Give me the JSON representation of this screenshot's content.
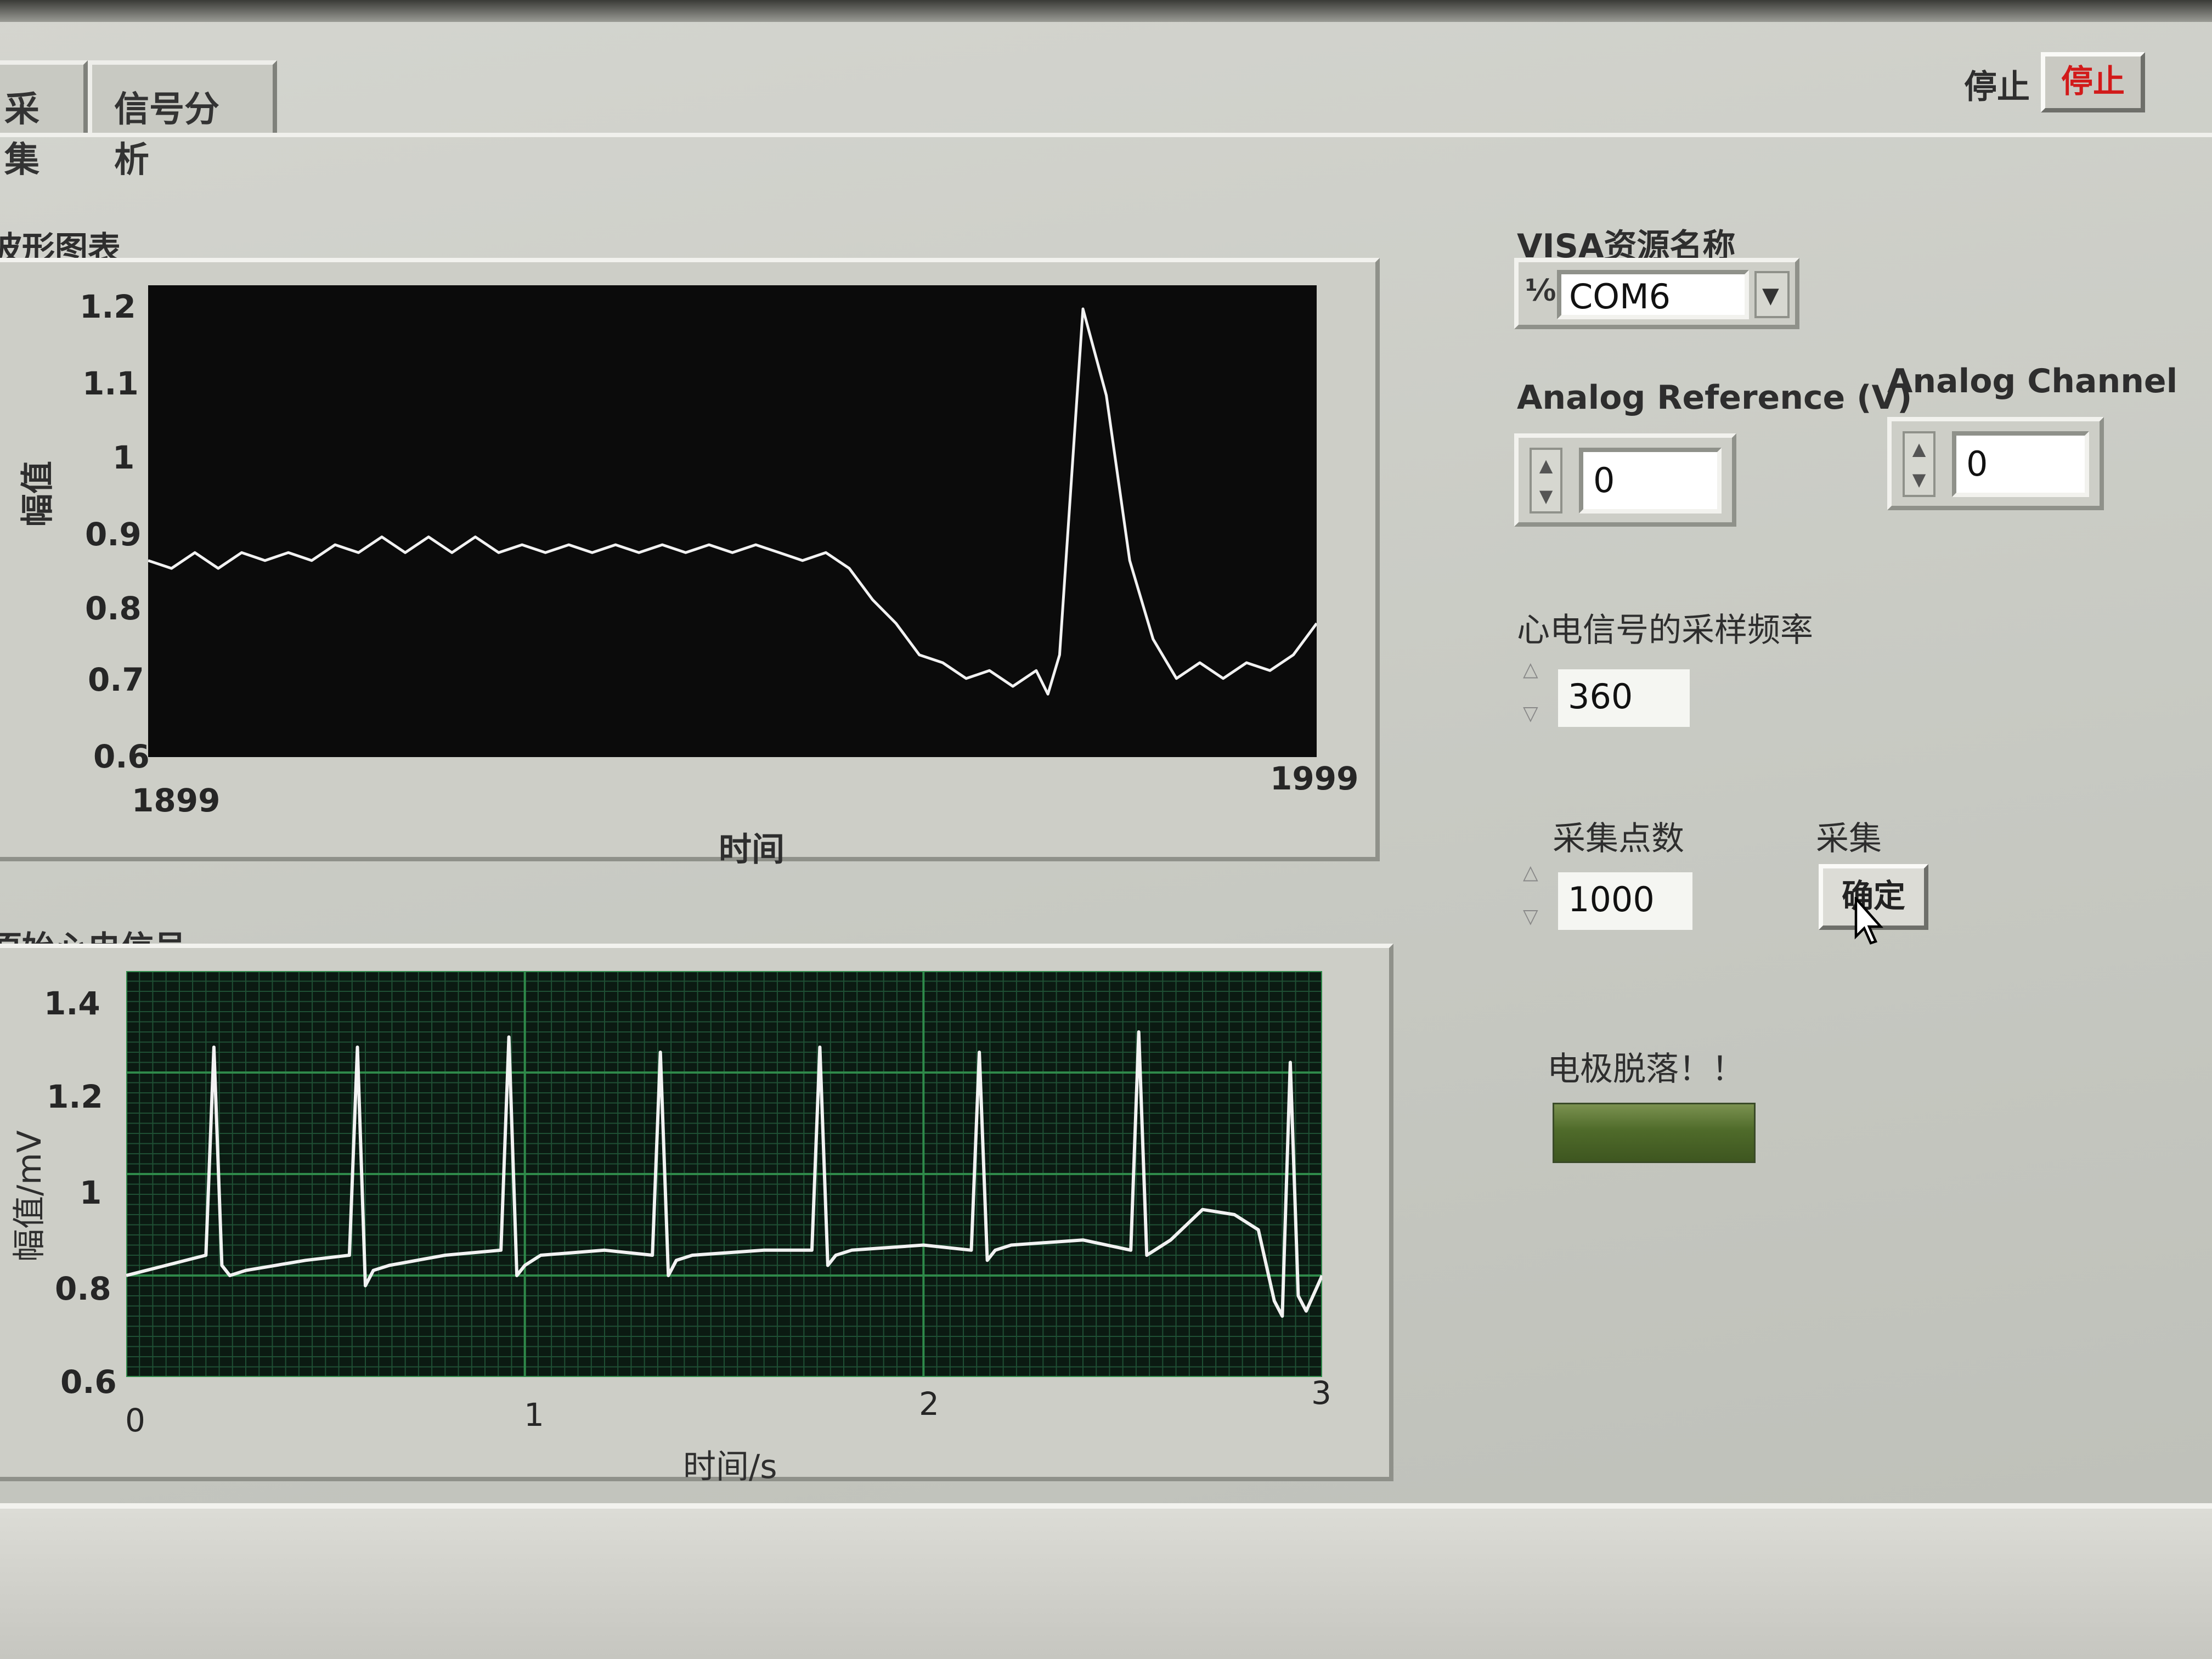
{
  "tabs": [
    {
      "label": "采集"
    },
    {
      "label": "信号分析"
    }
  ],
  "stop": {
    "label": "停止",
    "button_label": "停止"
  },
  "waveform_chart": {
    "title": "波形图表",
    "ylabel": "幅值",
    "xlabel": "时间",
    "y_ticks": [
      "1.2",
      "1.1",
      "1",
      "0.9",
      "0.8",
      "0.7",
      "0.6"
    ],
    "x_ticks": [
      "1899",
      "1999"
    ]
  },
  "raw_ecg": {
    "title": "原始心电信号",
    "ylabel": "幅值/mV",
    "xlabel": "时间/s",
    "y_ticks": [
      "1.4",
      "1.2",
      "1",
      "0.8",
      "0.6"
    ],
    "x_ticks": [
      "0",
      "1",
      "2",
      "3"
    ]
  },
  "visa": {
    "label": "VISA资源名称",
    "icon": "io-icon",
    "value": "COM6"
  },
  "analog_reference": {
    "label": "Analog Reference (V)",
    "value": "0"
  },
  "analog_channel": {
    "label": "Analog Channel",
    "value": "0"
  },
  "sample_rate": {
    "label": "心电信号的采样频率",
    "value": "360"
  },
  "sample_points": {
    "label": "采集点数",
    "value": "1000"
  },
  "acquire": {
    "label": "采集",
    "button_label": "确定"
  },
  "electrode": {
    "label": "电极脱落！！",
    "led_color": "#4f6b2a"
  },
  "chart_data": [
    {
      "type": "line",
      "title": "波形图表",
      "xlabel": "时间",
      "ylabel": "幅值",
      "xlim": [
        1899,
        1999
      ],
      "ylim": [
        0.6,
        1.2
      ],
      "x_ticks": [
        1899,
        1999
      ],
      "y_ticks": [
        0.6,
        0.7,
        0.8,
        0.9,
        1.0,
        1.1,
        1.2
      ],
      "grid": false,
      "series": [
        {
          "x": [
            1899,
            1901,
            1903,
            1905,
            1907,
            1909,
            1911,
            1913,
            1915,
            1917,
            1919,
            1921,
            1923,
            1925,
            1927,
            1929,
            1931,
            1933,
            1935,
            1937,
            1939,
            1941,
            1943,
            1945,
            1947,
            1949,
            1951,
            1953,
            1955,
            1957,
            1959,
            1961,
            1963,
            1965,
            1967,
            1969,
            1971,
            1973,
            1975,
            1976,
            1977,
            1978,
            1979,
            1981,
            1983,
            1985,
            1987,
            1989,
            1991,
            1993,
            1995,
            1997,
            1999
          ],
          "y": [
            0.85,
            0.84,
            0.86,
            0.84,
            0.86,
            0.85,
            0.86,
            0.85,
            0.87,
            0.86,
            0.88,
            0.86,
            0.88,
            0.86,
            0.88,
            0.86,
            0.87,
            0.86,
            0.87,
            0.86,
            0.87,
            0.86,
            0.87,
            0.86,
            0.87,
            0.86,
            0.87,
            0.86,
            0.85,
            0.86,
            0.84,
            0.8,
            0.77,
            0.73,
            0.72,
            0.7,
            0.71,
            0.69,
            0.71,
            0.68,
            0.73,
            0.95,
            1.17,
            1.06,
            0.85,
            0.75,
            0.7,
            0.72,
            0.7,
            0.72,
            0.71,
            0.73,
            0.77
          ]
        }
      ]
    },
    {
      "type": "line",
      "title": "原始心电信号",
      "xlabel": "时间/s",
      "ylabel": "幅值/mV",
      "xlim": [
        0,
        3
      ],
      "ylim": [
        0.6,
        1.4
      ],
      "x_ticks": [
        0,
        1,
        2,
        3
      ],
      "y_ticks": [
        0.6,
        0.8,
        1.0,
        1.2,
        1.4
      ],
      "grid": true,
      "series": [
        {
          "x": [
            0,
            0.1,
            0.2,
            0.22,
            0.24,
            0.26,
            0.3,
            0.45,
            0.56,
            0.58,
            0.6,
            0.62,
            0.66,
            0.8,
            0.94,
            0.96,
            0.98,
            1.0,
            1.04,
            1.2,
            1.32,
            1.34,
            1.36,
            1.38,
            1.42,
            1.6,
            1.72,
            1.74,
            1.76,
            1.78,
            1.82,
            2.0,
            2.12,
            2.14,
            2.16,
            2.18,
            2.22,
            2.4,
            2.52,
            2.54,
            2.56,
            2.58,
            2.62,
            2.7,
            2.78,
            2.84,
            2.88,
            2.9,
            2.92,
            2.94,
            2.96,
            3.0
          ],
          "y": [
            0.8,
            0.82,
            0.84,
            1.25,
            0.82,
            0.8,
            0.81,
            0.83,
            0.84,
            1.25,
            0.78,
            0.81,
            0.82,
            0.84,
            0.85,
            1.27,
            0.8,
            0.82,
            0.84,
            0.85,
            0.84,
            1.24,
            0.8,
            0.83,
            0.84,
            0.85,
            0.85,
            1.25,
            0.82,
            0.84,
            0.85,
            0.86,
            0.85,
            1.24,
            0.83,
            0.85,
            0.86,
            0.87,
            0.85,
            1.28,
            0.84,
            0.85,
            0.87,
            0.93,
            0.92,
            0.89,
            0.75,
            0.72,
            1.22,
            0.76,
            0.73,
            0.8
          ]
        }
      ]
    }
  ]
}
